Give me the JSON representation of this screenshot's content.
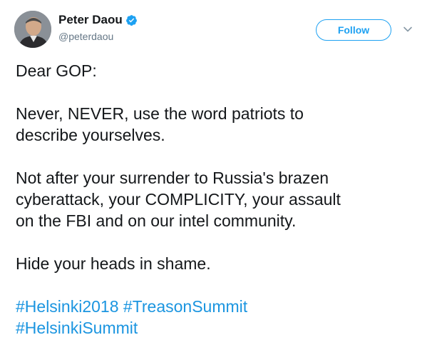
{
  "user": {
    "name": "Peter Daou",
    "handle": "@peterdaou",
    "verified_icon": "verified-badge-icon",
    "avatar_icon": "profile-photo"
  },
  "actions": {
    "follow_label": "Follow",
    "menu_icon": "chevron-down-icon"
  },
  "tweet": {
    "line1": "Dear GOP:",
    "para2_line1": "Never, NEVER, use the word patriots to",
    "para2_line2": "describe yourselves.",
    "para3_line1": "Not after your surrender to Russia's brazen",
    "para3_line2": "cyberattack, your COMPLICITY, your assault",
    "para3_line3": "on the FBI and on our intel community.",
    "para4_line1": "Hide your heads in shame.",
    "hashtags": [
      "#Helsinki2018",
      "#TreasonSummit",
      "#HelsinkiSummit"
    ]
  },
  "colors": {
    "accent": "#1da1f2",
    "hashtag": "#1b95e0",
    "text": "#14171a",
    "secondary": "#657786"
  }
}
